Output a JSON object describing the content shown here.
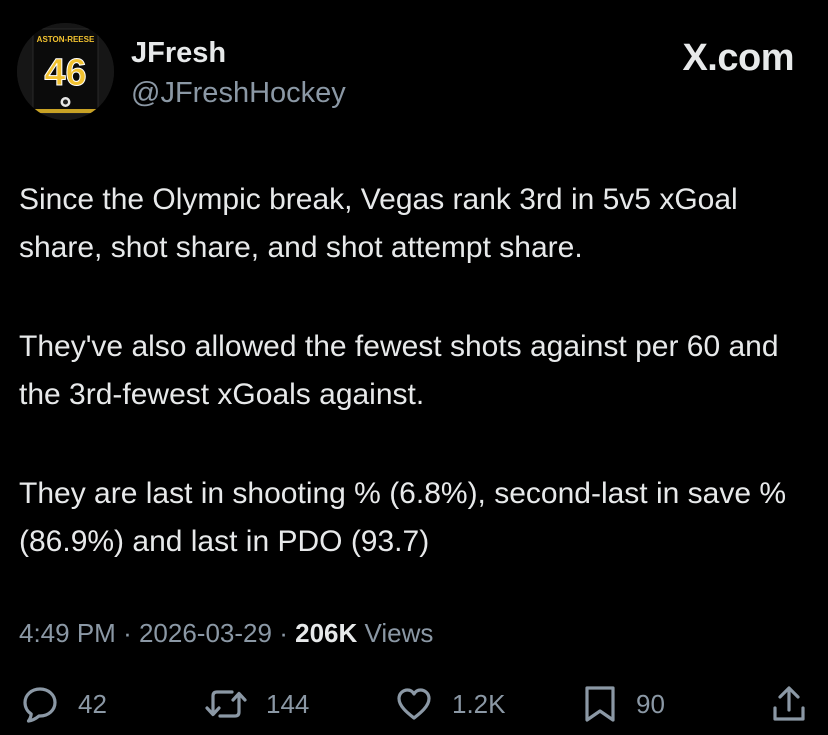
{
  "author": {
    "display_name": "JFresh",
    "handle": "@JFreshHockey",
    "avatar_jersey_name": "ASTON-REESE",
    "avatar_jersey_number": "46",
    "avatar_icon": "jersey-avatar-icon"
  },
  "brand": {
    "label": "X.com"
  },
  "tweet": {
    "paragraphs": [
      "Since the Olympic break, Vegas rank 3rd in 5v5 xGoal share, shot share, and shot attempt share.",
      "They've also allowed the fewest shots against per 60 and the 3rd-fewest xGoals against.",
      "They are last in shooting % (6.8%), second-last in save % (86.9%) and last in PDO (93.7)"
    ]
  },
  "meta": {
    "time": "4:49 PM",
    "separator": "·",
    "date": "2026-03-29",
    "views_count": "206K",
    "views_label": "Views"
  },
  "actions": {
    "reply": {
      "icon": "reply-icon",
      "count": "42"
    },
    "retweet": {
      "icon": "retweet-icon",
      "count": "144"
    },
    "like": {
      "icon": "heart-icon",
      "count": "1.2K"
    },
    "bookmark": {
      "icon": "bookmark-icon",
      "count": "90"
    },
    "share": {
      "icon": "share-icon"
    }
  },
  "colors": {
    "background": "#000000",
    "primary_text": "#e7e9ea",
    "secondary_text": "#8b98a5",
    "jersey_yellow": "#f2c230"
  }
}
